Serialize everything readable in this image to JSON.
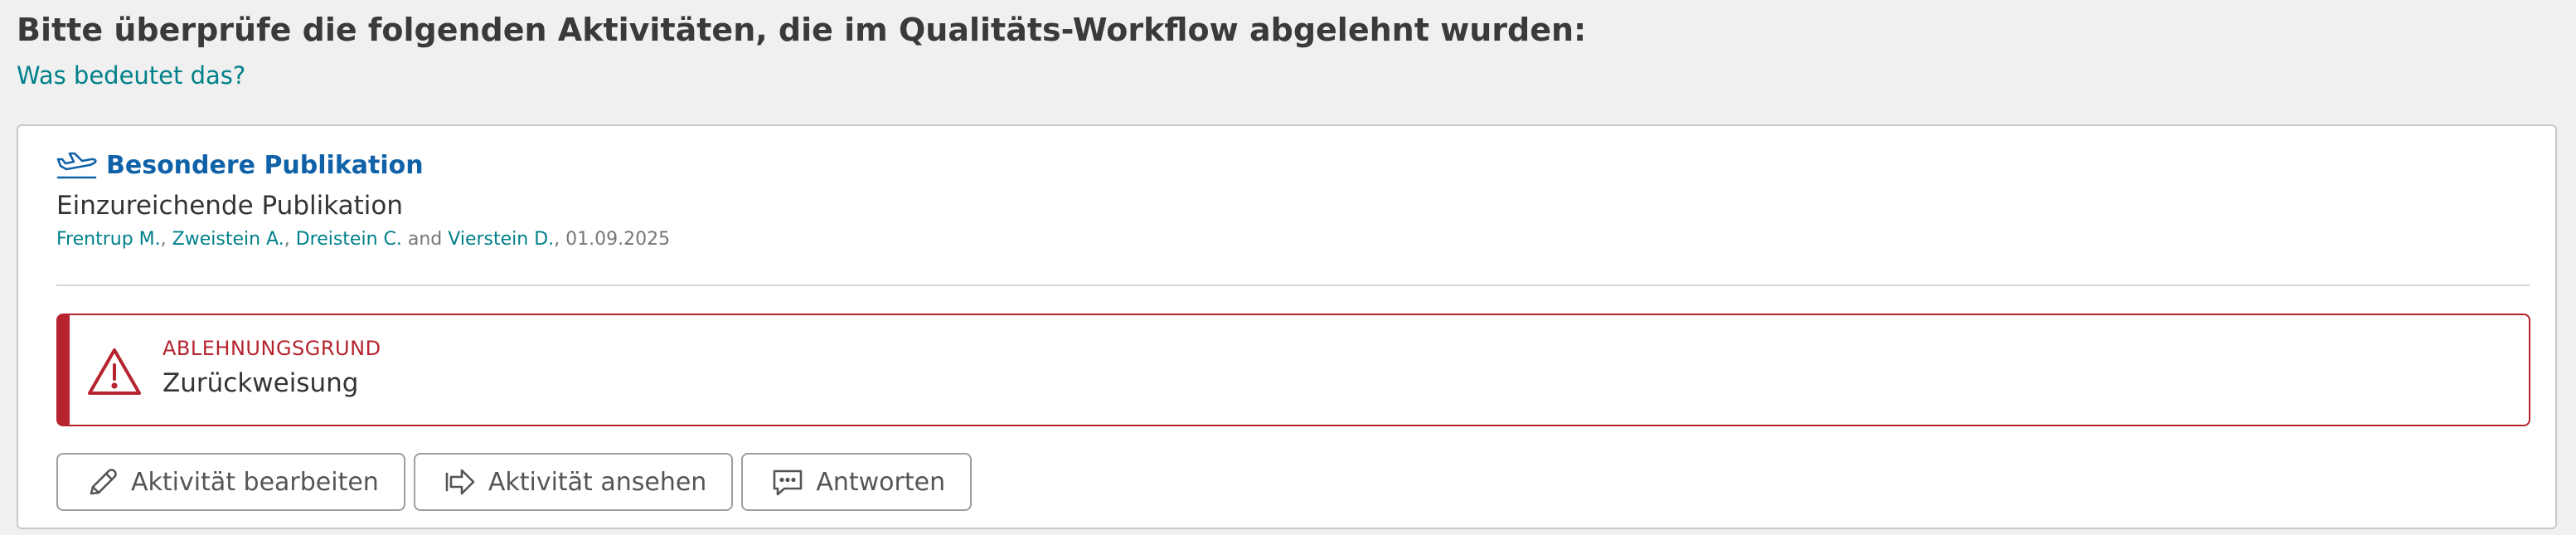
{
  "page": {
    "title": "Bitte überprüfe die folgenden Aktivitäten, die im Qualitäts-Workflow abgelehnt wurden:",
    "help_link": "Was bedeutet das?"
  },
  "activity": {
    "type_icon": "airplane-icon",
    "type_label": "Besondere Publikation",
    "title": "Einzureichende Publikation",
    "authors": [
      "Frentrup M.",
      "Zweistein A.",
      "Dreistein C.",
      "Vierstein D."
    ],
    "separator": ", ",
    "conjunction": " and ",
    "date": "01.09.2025"
  },
  "rejection": {
    "icon": "warning-triangle-icon",
    "label": "ABLEHNUNGSGRUND",
    "value": "Zurückweisung"
  },
  "actions": {
    "edit": {
      "icon": "pencil-icon",
      "label": "Aktivität bearbeiten"
    },
    "view": {
      "icon": "arrow-right-icon",
      "label": "Aktivität ansehen"
    },
    "reply": {
      "icon": "speech-bubble-icon",
      "label": "Antworten"
    }
  },
  "colors": {
    "link_teal": "#00808a",
    "type_blue": "#0f62a8",
    "danger_red": "#b5242f",
    "background": "#f0f0f0"
  }
}
